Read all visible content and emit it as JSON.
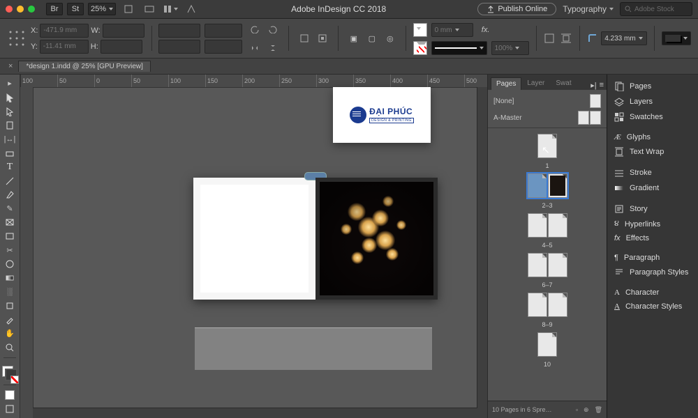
{
  "top": {
    "zoom": "25%",
    "title": "Adobe InDesign CC 2018",
    "publish": "Publish Online",
    "workspace": "Typography",
    "search_placeholder": "Adobe Stock"
  },
  "control": {
    "x_label": "X:",
    "x_val": "-471.9 mm",
    "y_label": "Y:",
    "y_val": "-11.41 mm",
    "w_label": "W:",
    "h_label": "H:",
    "shear": "0 mm",
    "opacity": "100%",
    "corner": "4.233 mm"
  },
  "document": {
    "tab": "*design 1.indd @ 25% [GPU Preview]"
  },
  "ruler_ticks": [
    "100",
    "50",
    "0",
    "50",
    "100",
    "150",
    "200",
    "250",
    "300",
    "350",
    "400",
    "450",
    "500"
  ],
  "logo": {
    "main": "ĐẠI PHÚC",
    "tag": "DESIGN & PRINTING"
  },
  "panel": {
    "tabs": [
      "Pages",
      "Layer",
      "Swat"
    ],
    "none": "[None]",
    "master": "A-Master",
    "page_labels": [
      "1",
      "2–3",
      "4–5",
      "6–7",
      "8–9",
      "10"
    ],
    "footer": "10 Pages in 6 Spre…"
  },
  "rail": {
    "items": [
      "Pages",
      "Layers",
      "Swatches",
      "",
      "Glyphs",
      "Text Wrap",
      "",
      "Stroke",
      "Gradient",
      "",
      "Story",
      "Hyperlinks",
      "Effects",
      "",
      "Paragraph",
      "Paragraph Styles",
      "",
      "Character",
      "Character Styles"
    ]
  }
}
